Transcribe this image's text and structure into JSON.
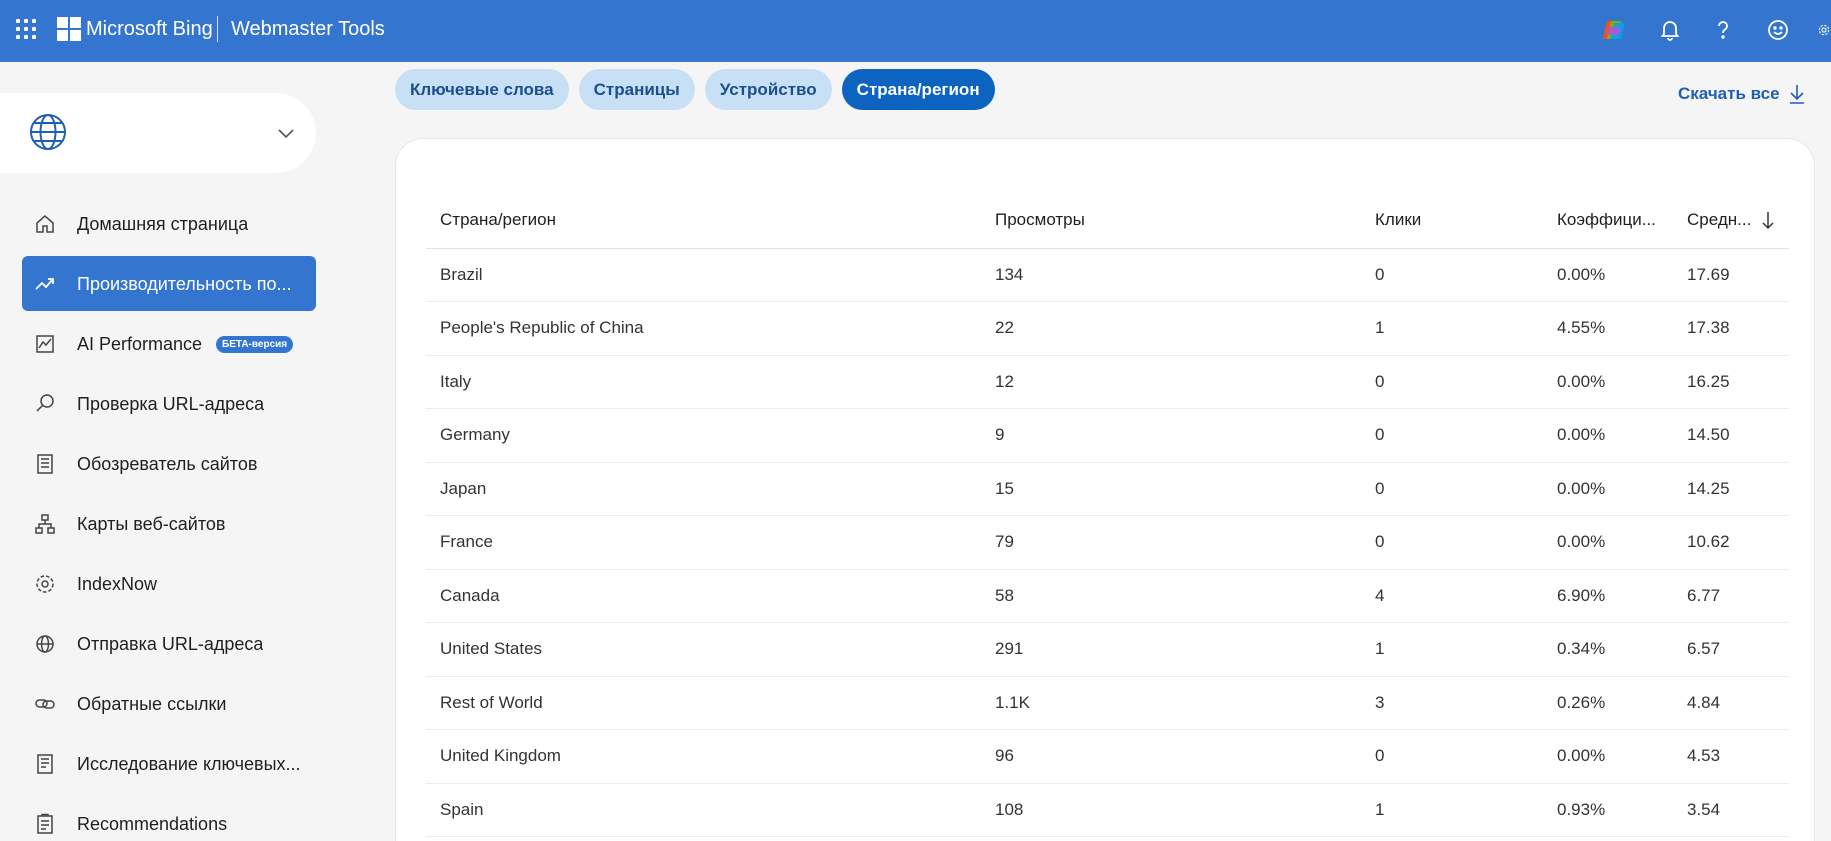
{
  "header": {
    "brand": "Microsoft Bing",
    "product": "Webmaster Tools",
    "accent": "#3476cf"
  },
  "site_selector": {
    "icon": "globe-icon",
    "value": ""
  },
  "sidebar": {
    "items": [
      {
        "label": "Домашняя страница",
        "icon": "home-icon",
        "active": false
      },
      {
        "label": "Производительность по...",
        "icon": "trending-up-icon",
        "active": true
      },
      {
        "label": "AI Performance",
        "icon": "chart-icon",
        "active": false,
        "badge": "БЕТА-версия"
      },
      {
        "label": "Проверка URL-адреса",
        "icon": "search-icon",
        "active": false
      },
      {
        "label": "Обозреватель сайтов",
        "icon": "document-icon",
        "active": false
      },
      {
        "label": "Карты веб-сайтов",
        "icon": "sitemap-icon",
        "active": false
      },
      {
        "label": "IndexNow",
        "icon": "gear-icon",
        "active": false
      },
      {
        "label": "Отправка URL-адреса",
        "icon": "globe-icon",
        "active": false
      },
      {
        "label": "Обратные ссылки",
        "icon": "link-icon",
        "active": false
      },
      {
        "label": "Исследование ключевых...",
        "icon": "document-icon",
        "active": false
      },
      {
        "label": "Recommendations",
        "icon": "clipboard-icon",
        "active": false
      }
    ]
  },
  "tabs": [
    {
      "label": "Ключевые слова",
      "active": false
    },
    {
      "label": "Страницы",
      "active": false
    },
    {
      "label": "Устройство",
      "active": false
    },
    {
      "label": "Страна/регион",
      "active": true
    }
  ],
  "download_label": "Скачать все",
  "table": {
    "columns": [
      "Страна/регион",
      "Просмотры",
      "Клики",
      "Коэффици...",
      "Средн..."
    ],
    "sort_column": 4,
    "sort_direction": "descending",
    "rows": [
      [
        "Brazil",
        "134",
        "0",
        "0.00%",
        "17.69"
      ],
      [
        "People's Republic of China",
        "22",
        "1",
        "4.55%",
        "17.38"
      ],
      [
        "Italy",
        "12",
        "0",
        "0.00%",
        "16.25"
      ],
      [
        "Germany",
        "9",
        "0",
        "0.00%",
        "14.50"
      ],
      [
        "Japan",
        "15",
        "0",
        "0.00%",
        "14.25"
      ],
      [
        "France",
        "79",
        "0",
        "0.00%",
        "10.62"
      ],
      [
        "Canada",
        "58",
        "4",
        "6.90%",
        "6.77"
      ],
      [
        "United States",
        "291",
        "1",
        "0.34%",
        "6.57"
      ],
      [
        "Rest of World",
        "1.1K",
        "3",
        "0.26%",
        "4.84"
      ],
      [
        "United Kingdom",
        "96",
        "0",
        "0.00%",
        "4.53"
      ],
      [
        "Spain",
        "108",
        "1",
        "0.93%",
        "3.54"
      ]
    ]
  }
}
